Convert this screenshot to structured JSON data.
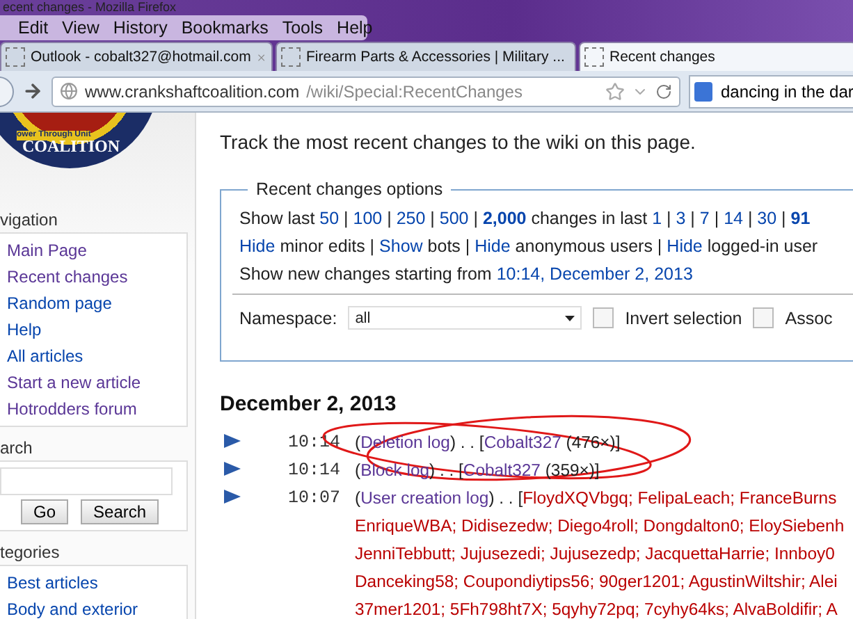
{
  "window": {
    "title": "ecent changes - Mozilla Firefox"
  },
  "menu": [
    "Edit",
    "View",
    "History",
    "Bookmarks",
    "Tools",
    "Help"
  ],
  "tabs": [
    {
      "label": "Outlook - cobalt327@hotmail.com",
      "selected": false
    },
    {
      "label": "Firearm Parts & Accessories | Military ...",
      "selected": false
    },
    {
      "label": "Recent changes",
      "selected": true
    }
  ],
  "address": {
    "host": "www.crankshaftcoalition.com",
    "path": "/wiki/Special:RecentChanges"
  },
  "web_search": {
    "value": "dancing in the dar"
  },
  "sidebar": {
    "logo": {
      "ring_text": "ower Through Unit",
      "name": "COALITION"
    },
    "sections": [
      {
        "kind": "links",
        "heading": "vigation",
        "items": [
          {
            "label": "Main Page",
            "visited": true
          },
          {
            "label": "Recent changes",
            "visited": true
          },
          {
            "label": "Random page",
            "visited": false
          },
          {
            "label": "Help",
            "visited": false
          },
          {
            "label": "All articles",
            "visited": false
          },
          {
            "label": "Start a new article",
            "visited": true
          },
          {
            "label": "Hotrodders forum",
            "visited": true
          }
        ]
      },
      {
        "kind": "search",
        "heading": "arch",
        "buttons": [
          "Go",
          "Search"
        ]
      },
      {
        "kind": "links",
        "heading": "tegories",
        "items": [
          {
            "label": "Best articles",
            "visited": false
          },
          {
            "label": "Body and exterior",
            "visited": false
          }
        ]
      }
    ]
  },
  "intro": "Track the most recent changes to the wiki on this page.",
  "options": {
    "legend": "Recent changes options",
    "lines": [
      [
        {
          "text": "Show last ",
          "kind": "plain"
        },
        {
          "text": "50",
          "kind": "link"
        },
        {
          "text": " | ",
          "kind": "plain"
        },
        {
          "text": "100",
          "kind": "link"
        },
        {
          "text": " | ",
          "kind": "plain"
        },
        {
          "text": "250",
          "kind": "link"
        },
        {
          "text": " | ",
          "kind": "plain"
        },
        {
          "text": "500",
          "kind": "link"
        },
        {
          "text": " | ",
          "kind": "plain"
        },
        {
          "text": "2,000",
          "kind": "current"
        },
        {
          "text": " changes in last ",
          "kind": "plain"
        },
        {
          "text": "1",
          "kind": "link"
        },
        {
          "text": " | ",
          "kind": "plain"
        },
        {
          "text": "3",
          "kind": "link"
        },
        {
          "text": " | ",
          "kind": "plain"
        },
        {
          "text": "7",
          "kind": "link"
        },
        {
          "text": " | ",
          "kind": "plain"
        },
        {
          "text": "14",
          "kind": "link"
        },
        {
          "text": " | ",
          "kind": "plain"
        },
        {
          "text": "30",
          "kind": "link"
        },
        {
          "text": " | ",
          "kind": "plain"
        },
        {
          "text": "91",
          "kind": "current"
        }
      ],
      [
        {
          "text": "Hide",
          "kind": "link"
        },
        {
          "text": " minor edits | ",
          "kind": "plain"
        },
        {
          "text": "Show",
          "kind": "link"
        },
        {
          "text": " bots | ",
          "kind": "plain"
        },
        {
          "text": "Hide",
          "kind": "link"
        },
        {
          "text": " anonymous users | ",
          "kind": "plain"
        },
        {
          "text": "Hide",
          "kind": "link"
        },
        {
          "text": " logged-in user",
          "kind": "plain"
        }
      ],
      [
        {
          "text": "Show new changes starting from ",
          "kind": "plain"
        },
        {
          "text": "10:14, December 2, 2013",
          "kind": "link"
        }
      ]
    ],
    "namespace": {
      "label": "Namespace:",
      "value": "all"
    },
    "checkboxes": [
      {
        "label": "Invert selection",
        "checked": false
      },
      {
        "label": "Assoc",
        "checked": false
      }
    ]
  },
  "changes": {
    "date": "December 2, 2013",
    "entries": [
      {
        "time": "10:14",
        "lines": [
          [
            {
              "text": "(",
              "kind": "plain"
            },
            {
              "text": "Deletion log",
              "kind": "visited"
            },
            {
              "text": ") . . [",
              "kind": "plain"
            },
            {
              "text": "Cobalt327",
              "kind": "visited"
            },
            {
              "text": " (476×)]",
              "kind": "plain"
            }
          ]
        ]
      },
      {
        "time": "10:14",
        "lines": [
          [
            {
              "text": "(",
              "kind": "plain"
            },
            {
              "text": "Block log",
              "kind": "visited"
            },
            {
              "text": ") . . [",
              "kind": "plain"
            },
            {
              "text": "Cobalt327",
              "kind": "visited"
            },
            {
              "text": " (359×)]",
              "kind": "plain"
            }
          ]
        ]
      },
      {
        "time": "10:07",
        "lines": [
          [
            {
              "text": "(",
              "kind": "plain"
            },
            {
              "text": "User creation log",
              "kind": "visited"
            },
            {
              "text": ") . . [",
              "kind": "plain"
            },
            {
              "text": "FloydXQVbgq; FelipaLeach; FranceBurns",
              "kind": "missing"
            }
          ],
          [
            {
              "text": "EnriqueWBA; Didisezedw; Diego4roll; Dongdalton0; EloySiebenh",
              "kind": "missing"
            }
          ],
          [
            {
              "text": "JenniTebbutt; Jujusezedi; Jujusezedp; JacquettaHarrie; Innboy0",
              "kind": "missing"
            }
          ],
          [
            {
              "text": "Danceking58; Coupondiytips56; 90ger1201; AgustinWiltshir; Alei",
              "kind": "missing"
            }
          ],
          [
            {
              "text": "37mer1201; 5Fh798ht7X; 5qyhy72pq; 7cyhy64ks; AlvaBoldifir; A",
              "kind": "missing"
            }
          ]
        ]
      }
    ]
  }
}
